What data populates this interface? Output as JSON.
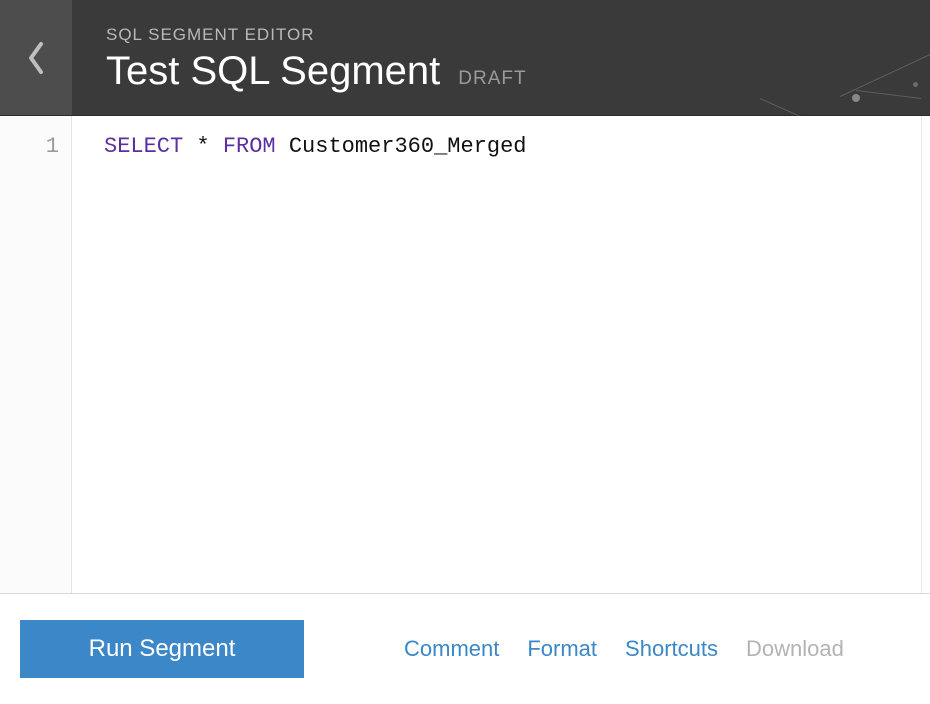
{
  "header": {
    "label": "SQL SEGMENT EDITOR",
    "title": "Test SQL Segment",
    "status": "DRAFT"
  },
  "editor": {
    "line_numbers": [
      "1"
    ],
    "code": {
      "kw1": "SELECT",
      "star": " * ",
      "kw2": "FROM",
      "rest": " Customer360_Merged"
    }
  },
  "toolbar": {
    "run_label": "Run Segment",
    "links": {
      "comment": "Comment",
      "format": "Format",
      "shortcuts": "Shortcuts",
      "download": "Download"
    }
  },
  "colors": {
    "accent": "#3b87c8",
    "keyword": "#5a2fa0",
    "muted": "#9a9a9a"
  }
}
